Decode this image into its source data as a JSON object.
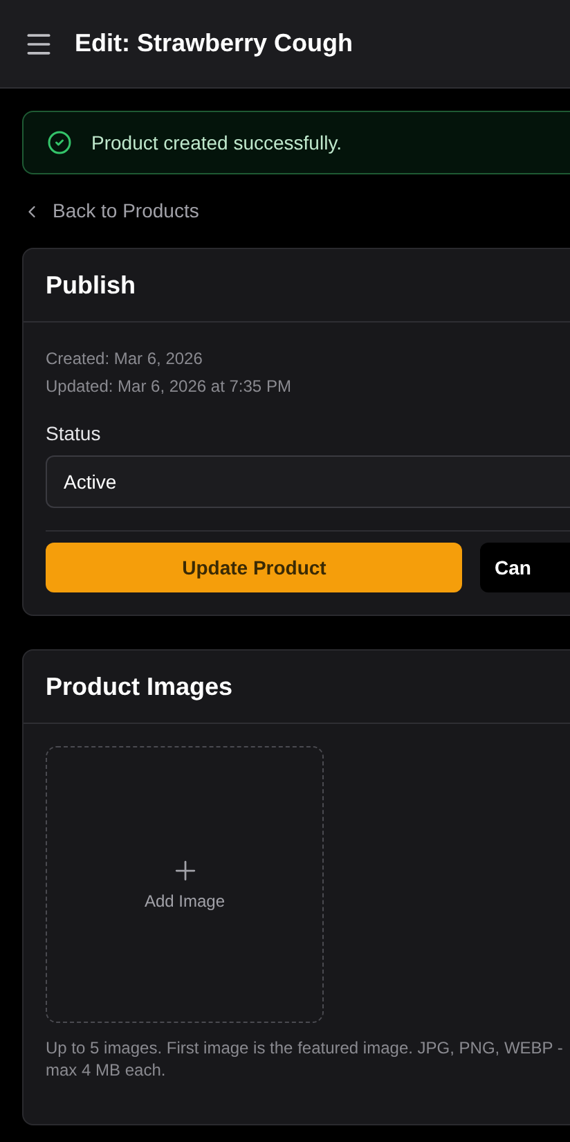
{
  "header": {
    "title": "Edit: Strawberry Cough"
  },
  "alert": {
    "kind": "success",
    "message": "Product created successfully."
  },
  "back_link": {
    "label": "Back to Products"
  },
  "publish": {
    "title": "Publish",
    "created": "Created: Mar 6, 2026",
    "updated": "Updated: Mar 6, 2026 at 7:35 PM",
    "status_label": "Status",
    "status_value": "Active",
    "buttons": [
      {
        "kind": "primary",
        "label": "Update Product"
      },
      {
        "kind": "secondary",
        "label": "Can"
      }
    ]
  },
  "images": {
    "title": "Product Images",
    "add_label": "Add Image",
    "hint": "Up to 5 images. First image is the featured image. JPG, PNG, WEBP - max 4 MB each."
  }
}
